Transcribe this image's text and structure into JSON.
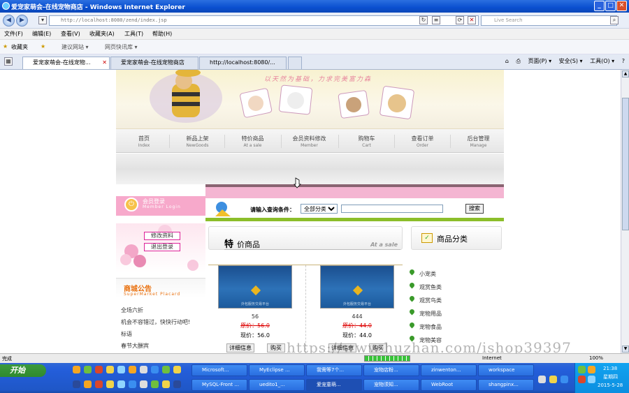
{
  "window": {
    "title": "爱宠家萌会-在线宠物商店 - Windows Internet Explorer"
  },
  "address": {
    "url": "http://localhost:8080/zend/index.jsp",
    "search_placeholder": "Live Search"
  },
  "menu": [
    "文件(F)",
    "编辑(E)",
    "查看(V)",
    "收藏夹(A)",
    "工具(T)",
    "帮助(H)"
  ],
  "favorites": {
    "label": "收藏夹",
    "items": [
      "建议网站 ▾",
      "网页快讯库 ▾"
    ]
  },
  "tabs": [
    {
      "label": "爱宠家萌会-在线宠物..."
    },
    {
      "label": "爱宠家萌会-在线宠物商店"
    },
    {
      "label": "http://localhost:8080/..."
    }
  ],
  "ie_tools": [
    "页面(P) ▾",
    "安全(S) ▾",
    "工具(O) ▾"
  ],
  "banner": {
    "slogan": "以天然为基础，力求完美富力森"
  },
  "nav": [
    {
      "cn": "首页",
      "en": "Index"
    },
    {
      "cn": "新品上架",
      "en": "NewGoods"
    },
    {
      "cn": "特价商品",
      "en": "At a sale"
    },
    {
      "cn": "会员资料修改",
      "en": "Member"
    },
    {
      "cn": "购物车",
      "en": "Cart"
    },
    {
      "cn": "查看订单",
      "en": "Order"
    },
    {
      "cn": "后台管理",
      "en": "Manage"
    }
  ],
  "member": {
    "title": "会员登录",
    "subtitle": "Member Login",
    "buttons": [
      "修改资料",
      "退出登录"
    ]
  },
  "notice": {
    "title": "商城公告",
    "subtitle": "SuperMarket Placard",
    "items": [
      "全场六折",
      "机会不容错过，快快行动吧!",
      "标语",
      "春节大酬宾"
    ]
  },
  "search": {
    "label": "请输入查询条件：",
    "select_value": "全部分类",
    "button": "搜索"
  },
  "special": {
    "title_big": "特",
    "title_rest": "价商品",
    "title_en": "At a sale"
  },
  "products": [
    {
      "image_caption": "外包服务交易平台",
      "name": "56",
      "old_price": "原价：56.0",
      "now_price": "现价：56.0",
      "detail_btn": "详细信息",
      "buy_btn": "购买"
    },
    {
      "image_caption": "外包服务交易平台",
      "name": "444",
      "old_price": "原价：44.0",
      "now_price": "现价：44.0",
      "detail_btn": "详细信息",
      "buy_btn": "购买"
    }
  ],
  "categories": {
    "title": "商品分类",
    "items": [
      "小宠类",
      "观赏鱼类",
      "观赏鸟类",
      "宠物用品",
      "宠物食品",
      "宠物美容"
    ]
  },
  "watermark": "https://www.huzhan.com/ishop39397",
  "status": {
    "done": "完成",
    "zone": "Internet",
    "zoom": "100%"
  },
  "taskbar": {
    "start": "开始",
    "row1": [
      "Microsoft...",
      "MyEclipse ...",
      "我需等7个...",
      "宠物店粉...",
      "zinwenton...",
      "workspace"
    ],
    "row2": [
      "MySQL-Front ...",
      "uedito1_...",
      "爱宠童萌...",
      "宠物须知...",
      "WebRoot",
      "shangpinx..."
    ],
    "time": "21:38",
    "day": "星期四",
    "date": "2015-5-28"
  },
  "colors": {
    "pink": "#f4b5d2",
    "green_bar": "#8cbe2a",
    "orange_title": "#e96f0c",
    "xp_blue": "#245edb"
  }
}
